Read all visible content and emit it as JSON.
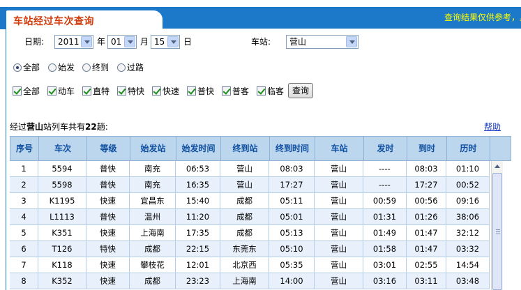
{
  "header": {
    "title": "车站经过车次查询",
    "note": "查询结果仅供参考，具体"
  },
  "form": {
    "date_label": "日期:",
    "year_value": "2011",
    "year_unit": "年",
    "month_value": "01",
    "month_unit": "月",
    "day_value": "15",
    "day_unit": "日",
    "station_label": "车站:",
    "station_value": "营山",
    "radios": [
      {
        "label": "全部",
        "checked": true
      },
      {
        "label": "始发",
        "checked": false
      },
      {
        "label": "终到",
        "checked": false
      },
      {
        "label": "过路",
        "checked": false
      }
    ],
    "checks": [
      {
        "label": "全部",
        "checked": true
      },
      {
        "label": "动车",
        "checked": true
      },
      {
        "label": "直特",
        "checked": true
      },
      {
        "label": "特快",
        "checked": true
      },
      {
        "label": "快速",
        "checked": true
      },
      {
        "label": "普快",
        "checked": true
      },
      {
        "label": "普客",
        "checked": true
      },
      {
        "label": "临客",
        "checked": true
      }
    ],
    "query_button": "查询"
  },
  "summary": {
    "prefix": "经过",
    "station": "营山",
    "middle": "站列车共有",
    "count": "22",
    "suffix": "趟:"
  },
  "help_link": "帮助",
  "table": {
    "headers": [
      "序号",
      "车次",
      "等级",
      "始发站",
      "始发时间",
      "终到站",
      "终到时间",
      "车站",
      "发时",
      "到时",
      "历时"
    ],
    "rows": [
      [
        "1",
        "5594",
        "普快",
        "南充",
        "06:53",
        "营山",
        "08:03",
        "营山",
        "----",
        "08:03",
        "01:10"
      ],
      [
        "2",
        "5598",
        "普快",
        "南充",
        "16:35",
        "营山",
        "17:27",
        "营山",
        "----",
        "17:27",
        "00:52"
      ],
      [
        "3",
        "K1195",
        "快速",
        "宜昌东",
        "15:40",
        "成都",
        "05:11",
        "营山",
        "00:59",
        "00:56",
        "09:16"
      ],
      [
        "4",
        "L1113",
        "普快",
        "温州",
        "11:20",
        "成都",
        "05:01",
        "营山",
        "01:31",
        "01:26",
        "38:06"
      ],
      [
        "5",
        "K351",
        "快速",
        "上海南",
        "17:35",
        "成都",
        "05:13",
        "营山",
        "01:49",
        "01:47",
        "32:12"
      ],
      [
        "6",
        "T126",
        "特快",
        "成都",
        "22:15",
        "东莞东",
        "05:10",
        "营山",
        "01:58",
        "01:47",
        "03:32"
      ],
      [
        "7",
        "K118",
        "快速",
        "攀枝花",
        "12:01",
        "北京西",
        "05:35",
        "营山",
        "03:01",
        "02:55",
        "14:54"
      ],
      [
        "8",
        "K352",
        "快速",
        "成都",
        "23:23",
        "上海南",
        "14:00",
        "营山",
        "03:16",
        "03:11",
        "03:48"
      ]
    ]
  }
}
